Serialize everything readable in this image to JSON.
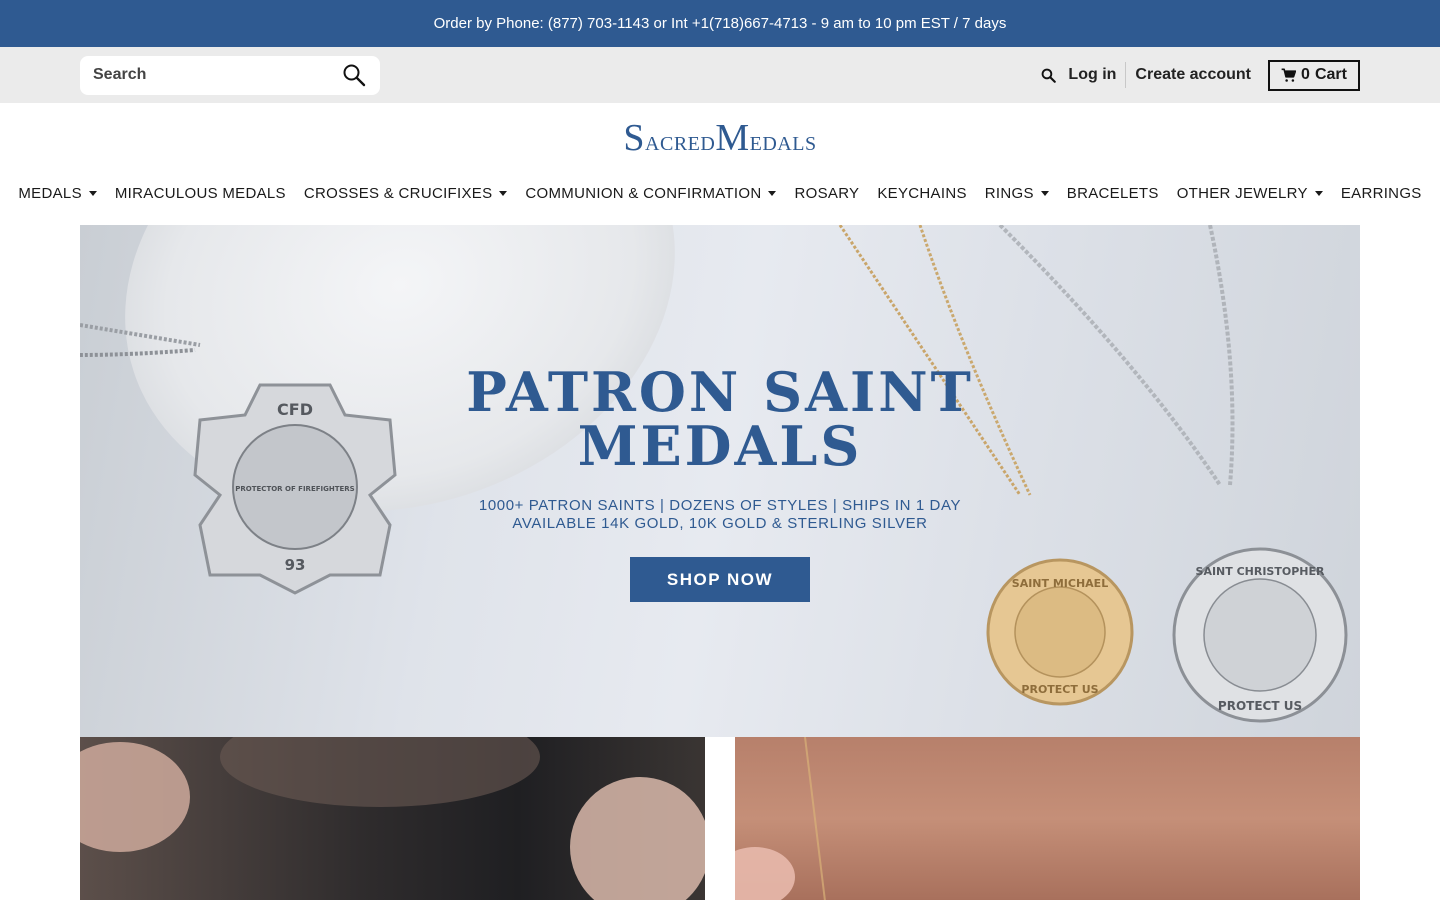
{
  "announcement": "Order by Phone: (877) 703-1143 or Int +1(718)667-4713 - 9 am to 10 pm EST / 7 days",
  "utility": {
    "search_placeholder": "Search",
    "login": "Log in",
    "create_account": "Create account",
    "cart_count": "0",
    "cart_label": "Cart"
  },
  "logo": {
    "first_cap": "S",
    "first_rest": "acred",
    "second_cap": "M",
    "second_rest": "edals"
  },
  "nav": [
    {
      "label": "MEDALS",
      "dropdown": true
    },
    {
      "label": "MIRACULOUS MEDALS",
      "dropdown": false
    },
    {
      "label": "CROSSES & CRUCIFIXES",
      "dropdown": true
    },
    {
      "label": "COMMUNION & CONFIRMATION",
      "dropdown": true
    },
    {
      "label": "ROSARY",
      "dropdown": false
    },
    {
      "label": "KEYCHAINS",
      "dropdown": false
    },
    {
      "label": "RINGS",
      "dropdown": true
    },
    {
      "label": "BRACELETS",
      "dropdown": false
    },
    {
      "label": "OTHER JEWELRY",
      "dropdown": true
    },
    {
      "label": "EARRINGS",
      "dropdown": false
    }
  ],
  "hero": {
    "title_line1": "PATRON SAINT",
    "title_line2": "MEDALS",
    "sub_line1": "1000+ PATRON SAINTS | DOZENS OF STYLES | SHIPS IN 1 DAY",
    "sub_line2": "AVAILABLE 14K GOLD,  10K GOLD & STERLING SILVER",
    "cta": "SHOP NOW",
    "medal_fd_top": "CFD",
    "medal_fd_bottom": "93",
    "medal_fd_ring": "PROTECTOR OF FIREFIGHTERS",
    "medal_gold_text": "SAINT MICHAEL",
    "medal_gold_bottom": "PROTECT US",
    "medal_silver_text": "SAINT CHRISTOPHER",
    "medal_silver_bottom": "PROTECT US"
  },
  "colors": {
    "brand": "#2f5a91",
    "utility_bg": "#ebebeb"
  }
}
